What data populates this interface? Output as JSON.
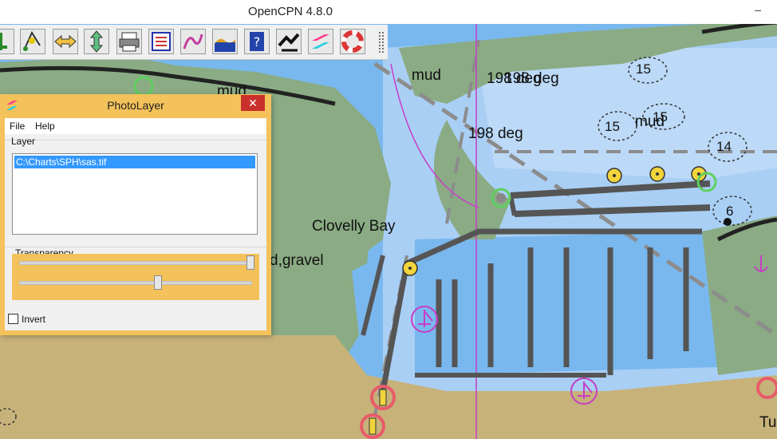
{
  "window": {
    "title": "OpenCPN 4.8.0",
    "minimize_glyph": "–"
  },
  "toolbar": {
    "buttons": [
      {
        "name": "zoom-in-icon"
      },
      {
        "name": "route-icon"
      },
      {
        "name": "pan-horizontal-icon"
      },
      {
        "name": "pan-vertical-icon"
      },
      {
        "name": "print-icon"
      },
      {
        "name": "route-manager-icon"
      },
      {
        "name": "track-icon"
      },
      {
        "name": "tide-icon"
      },
      {
        "name": "help-icon"
      },
      {
        "name": "ais-icon"
      },
      {
        "name": "photolayer-icon"
      },
      {
        "name": "mob-icon"
      }
    ]
  },
  "chart": {
    "labels": {
      "mud_1": "mud",
      "mud_2": "mud",
      "mud_3": "mud",
      "deg_1": "198 deg",
      "deg_2": "198 deg",
      "deg_3": "198 deg",
      "bay": "Clovelly Bay",
      "gravel": "d,gravel",
      "tu": "Tu"
    },
    "depths": {
      "d1": "15",
      "d2": "15",
      "d3": "15",
      "d4": "14",
      "d5": "6"
    }
  },
  "photolayer": {
    "title": "PhotoLayer",
    "close_glyph": "✕",
    "menu": {
      "file": "File",
      "help": "Help"
    },
    "layer_group": "Layer",
    "layers": [
      "C:\\Charts\\SPH\\sas.tif"
    ],
    "transparency_group": "Transparency",
    "slider_1_value": 1.0,
    "slider_2_value": 0.6,
    "invert_label": "Invert",
    "invert_checked": false
  },
  "colors": {
    "land": "#c7b27a",
    "green_land": "#8aab84",
    "deep_water": "#79b8ee",
    "shallow_water": "#a9cff5",
    "dialog_frame": "#f4c25a",
    "selection": "#3399ff",
    "close_button": "#c9302c"
  }
}
